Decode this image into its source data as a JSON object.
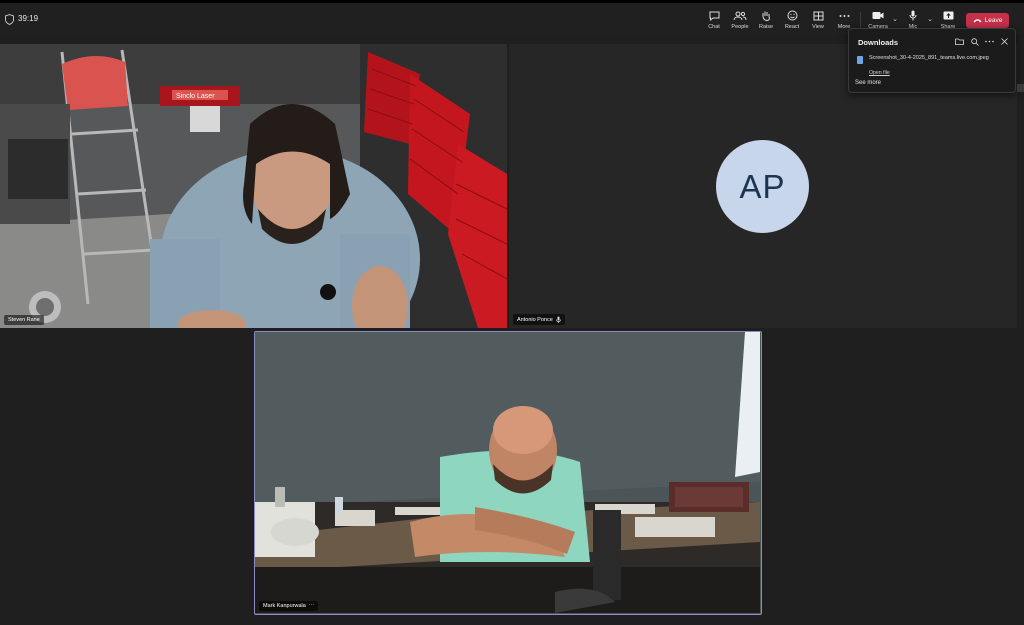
{
  "meeting": {
    "timer": "39:19"
  },
  "controls": [
    {
      "label": "Chat",
      "icon": "chat-icon"
    },
    {
      "label": "People",
      "icon": "people-icon"
    },
    {
      "label": "Raise",
      "icon": "raise-hand-icon"
    },
    {
      "label": "React",
      "icon": "react-icon"
    },
    {
      "label": "View",
      "icon": "view-icon"
    },
    {
      "label": "More",
      "icon": "more-icon"
    },
    {
      "label": "Camera",
      "icon": "camera-icon"
    },
    {
      "label": "Mic",
      "icon": "mic-icon"
    },
    {
      "label": "Share",
      "icon": "share-icon"
    }
  ],
  "leave_label": "Leave",
  "participants": {
    "steven": {
      "name": "Steven Rane",
      "overlay_sign": "Sinclo Laser"
    },
    "antonio": {
      "name": "Antonio Ponce",
      "initials": "AP"
    },
    "mark": {
      "name": "Mark Kanpurwala"
    }
  },
  "downloads": {
    "title": "Downloads",
    "file_name": "Screenshot_30-4-2025_891_teams.live.com.jpeg",
    "open_label": "Open file",
    "see_more": "See more"
  },
  "colors": {
    "leave": "#c4314b",
    "active_speaker_border": "#8b8cc7",
    "avatar_bg": "#c7d6ea"
  }
}
